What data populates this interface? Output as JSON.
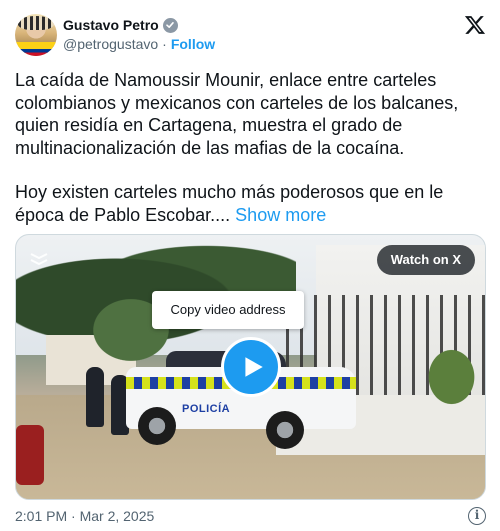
{
  "author": {
    "name": "Gustavo Petro",
    "handle": "@petrogustavo",
    "follow_label": "Follow",
    "separator": "·"
  },
  "tweet": {
    "paragraph1": "La caída de Namoussir Mounir, enlace entre carteles colombianos y mexicanos con carteles de los balcanes, quien residía en Cartagena, muestra el grado de multinacionalización de las mafias de la cocaína.",
    "paragraph2": "Hoy existen carteles mucho más poderosos que en le época de Pablo Escobar....",
    "show_more": "Show more"
  },
  "media": {
    "watch_label": "Watch on X",
    "context_menu_item": "Copy video address",
    "vehicle_text": "POLICÍA"
  },
  "footer": {
    "timestamp": "2:01 PM · Mar 2, 2025",
    "info_icon_glyph": "i"
  },
  "icons": [
    "avatar",
    "verified-badge-icon",
    "x-logo-icon",
    "video-watermark-icon",
    "play-icon",
    "info-icon"
  ],
  "colors": {
    "accent": "#1d9bf0",
    "secondary_text": "#536471",
    "primary_text": "#0f1419"
  }
}
